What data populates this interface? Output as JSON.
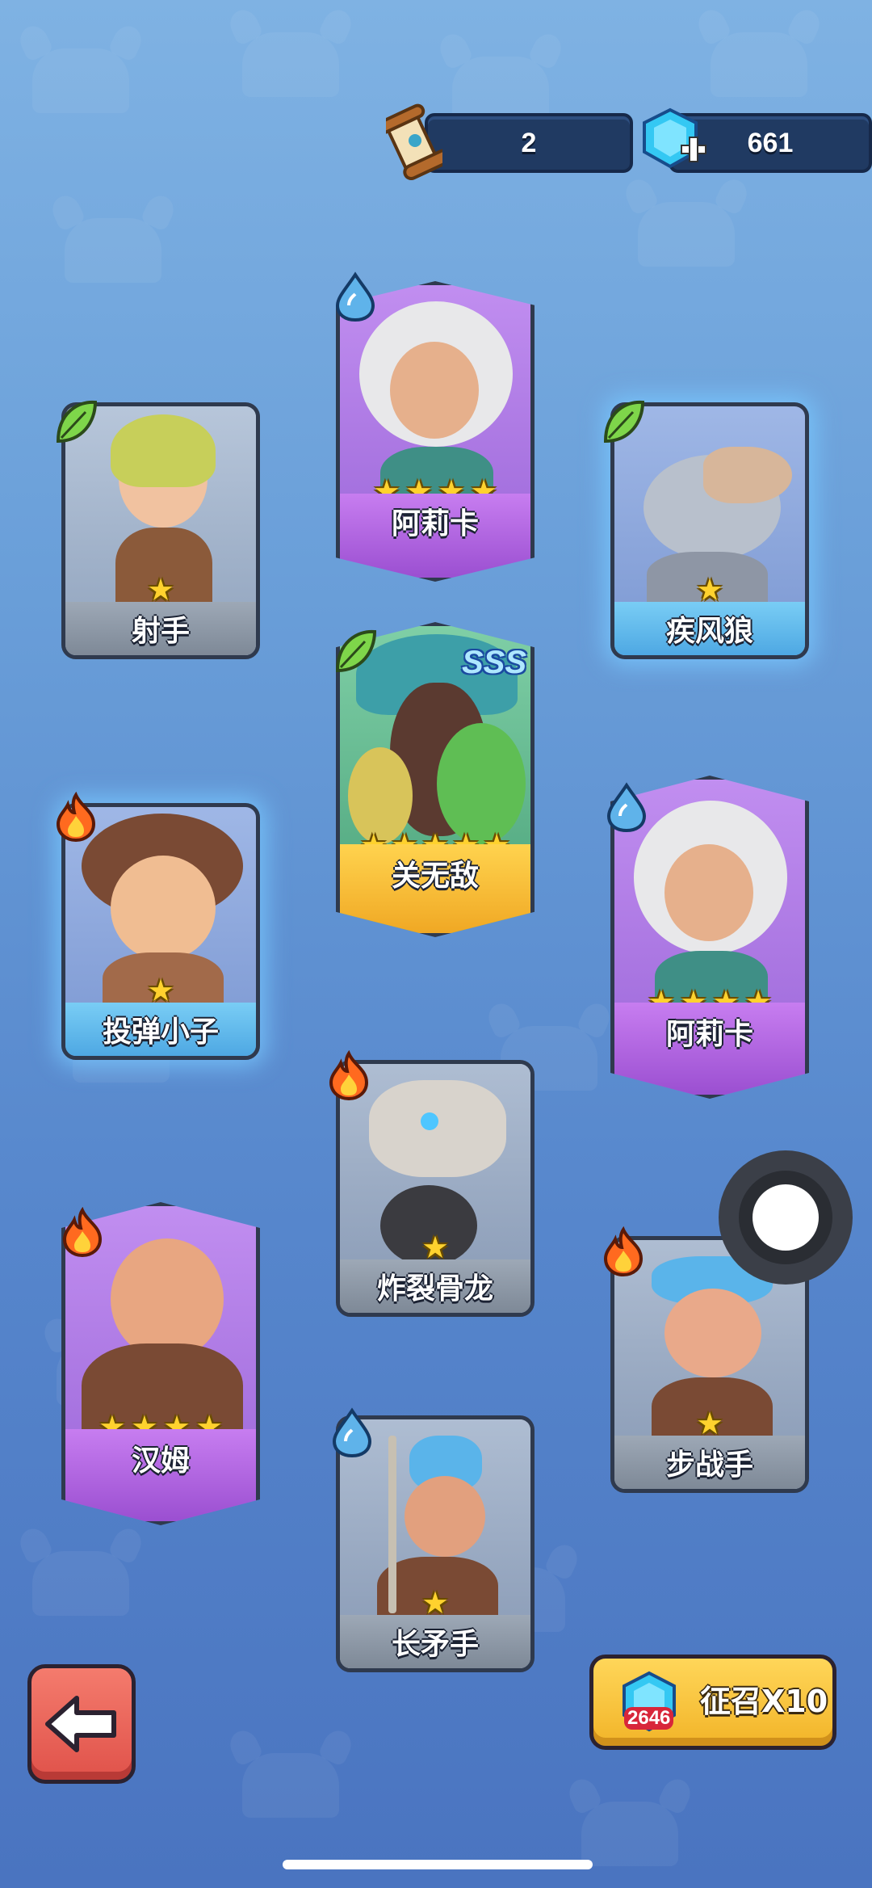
{
  "resources": {
    "scroll_count": "2",
    "gem_count": "661"
  },
  "cards": [
    {
      "id": "archer",
      "name": "射手",
      "element": "leaf-icon",
      "rarity": "gray",
      "stars": 1
    },
    {
      "id": "alika-top",
      "name": "阿莉卡",
      "element": "water-drop-icon",
      "rarity": "purple",
      "stars": 4
    },
    {
      "id": "wolf",
      "name": "疾风狼",
      "element": "leaf-icon",
      "rarity": "blue",
      "stars": 1
    },
    {
      "id": "guan",
      "name": "关无敌",
      "element": "leaf-icon",
      "rarity": "gold",
      "stars": 5,
      "badge": "SSS"
    },
    {
      "id": "catapult",
      "name": "投弹小子",
      "element": "fire-icon",
      "rarity": "blue",
      "stars": 1
    },
    {
      "id": "alika-mid",
      "name": "阿莉卡",
      "element": "water-drop-icon",
      "rarity": "purple",
      "stars": 4
    },
    {
      "id": "bone-dragon",
      "name": "炸裂骨龙",
      "element": "fire-icon",
      "rarity": "gray",
      "stars": 1
    },
    {
      "id": "ham",
      "name": "汉姆",
      "element": "fire-icon",
      "rarity": "purple",
      "stars": 4
    },
    {
      "id": "infantry",
      "name": "步战手",
      "element": "fire-icon",
      "rarity": "gray",
      "stars": 1
    },
    {
      "id": "spearman",
      "name": "长矛手",
      "element": "water-drop-icon",
      "rarity": "gray",
      "stars": 1
    }
  ],
  "buttons": {
    "back_icon": "arrow-left-icon",
    "summon_label": "征召X10",
    "summon_cost": "2646"
  },
  "colors": {
    "gray_bar": "#8a95a3",
    "blue_bar": "#5cb8ec",
    "purple_bar": "#b066e0",
    "gold_bar": "#f7c33a",
    "star": "#ffd22e"
  }
}
